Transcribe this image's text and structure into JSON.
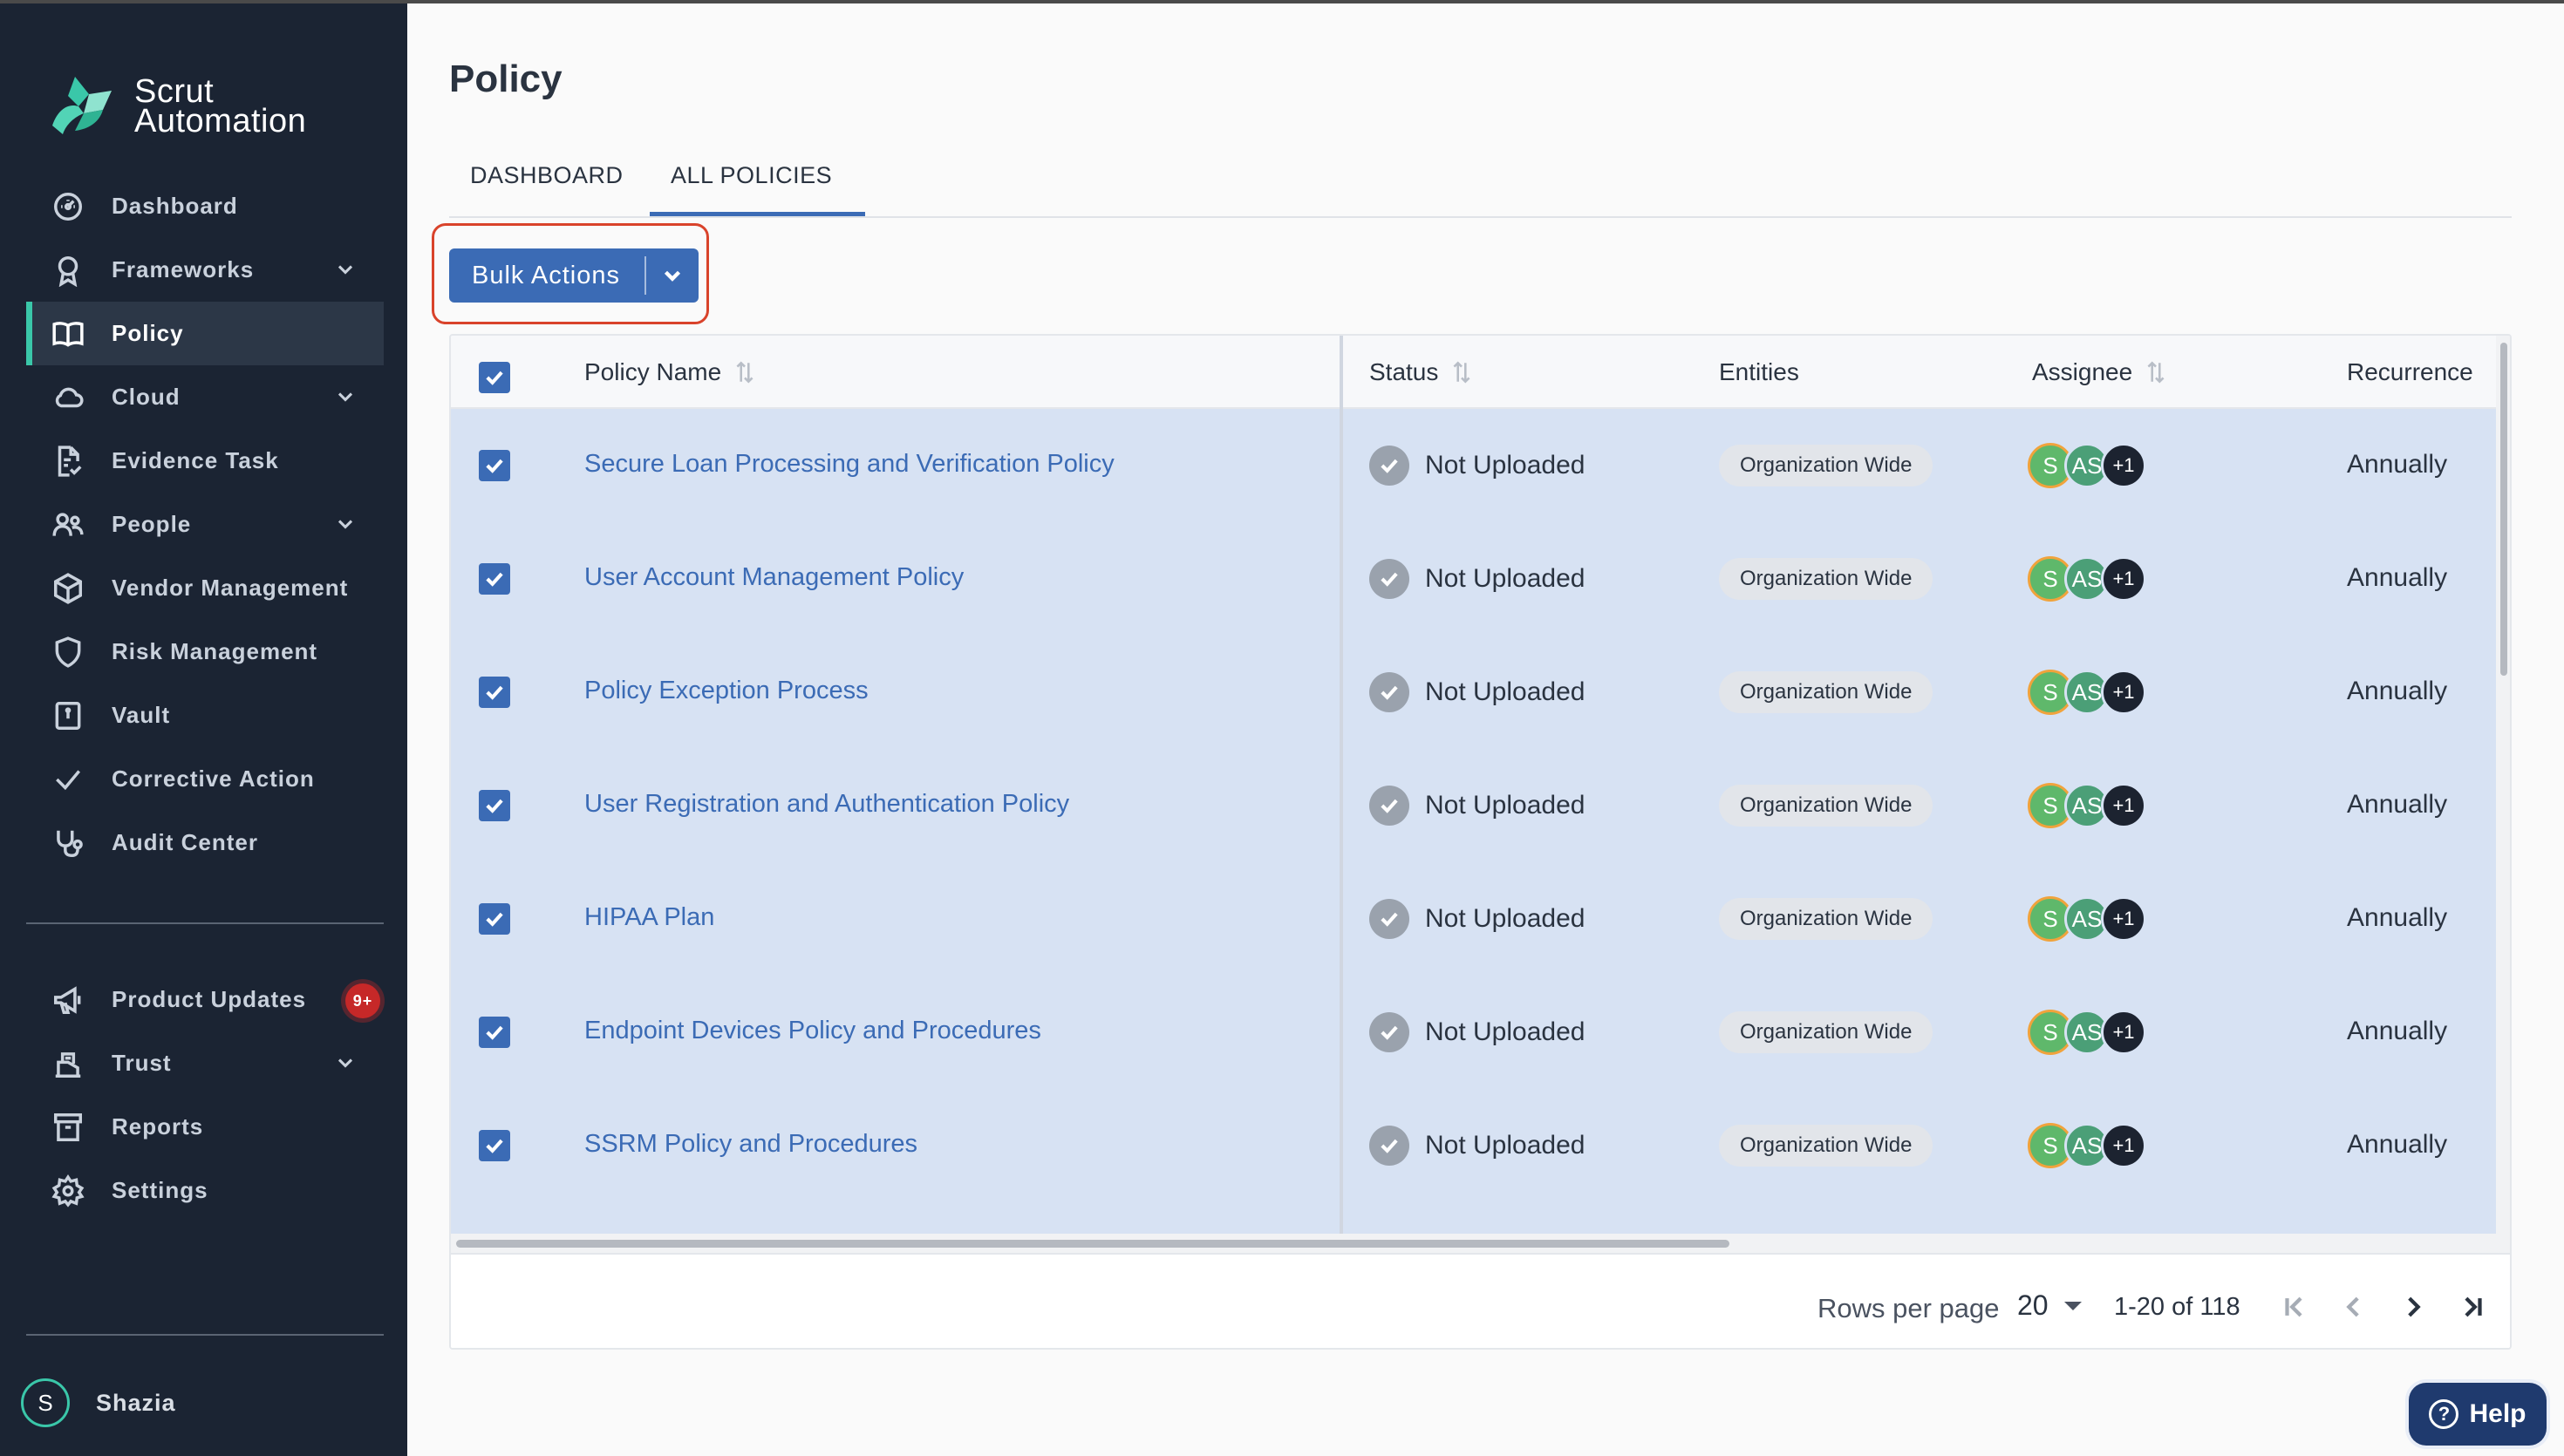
{
  "app": {
    "brand_line1": "Scrut",
    "brand_line2": "Automation"
  },
  "sidebar": {
    "items": [
      {
        "label": "Dashboard",
        "icon": "dashboard-gauge-icon",
        "expandable": false,
        "active": false
      },
      {
        "label": "Frameworks",
        "icon": "award-icon",
        "expandable": true,
        "active": false
      },
      {
        "label": "Policy",
        "icon": "book-icon",
        "expandable": false,
        "active": true
      },
      {
        "label": "Cloud",
        "icon": "cloud-icon",
        "expandable": true,
        "active": false
      },
      {
        "label": "Evidence Task",
        "icon": "file-check-icon",
        "expandable": false,
        "active": false
      },
      {
        "label": "People",
        "icon": "people-icon",
        "expandable": true,
        "active": false
      },
      {
        "label": "Vendor Management",
        "icon": "box-icon",
        "expandable": false,
        "active": false
      },
      {
        "label": "Risk Management",
        "icon": "shield-icon",
        "expandable": false,
        "active": false
      },
      {
        "label": "Vault",
        "icon": "vault-icon",
        "expandable": false,
        "active": false
      },
      {
        "label": "Corrective Action",
        "icon": "check-icon",
        "expandable": false,
        "active": false
      },
      {
        "label": "Audit Center",
        "icon": "stethoscope-icon",
        "expandable": false,
        "active": false
      }
    ],
    "secondary_items": [
      {
        "label": "Product Updates",
        "icon": "megaphone-icon",
        "expandable": false,
        "badge": "9+"
      },
      {
        "label": "Trust",
        "icon": "trust-icon",
        "expandable": true
      },
      {
        "label": "Reports",
        "icon": "archive-icon",
        "expandable": false
      },
      {
        "label": "Settings",
        "icon": "gear-icon",
        "expandable": false
      }
    ],
    "user": {
      "initial": "S",
      "name": "Shazia"
    }
  },
  "header": {
    "title": "Policy"
  },
  "tabs": [
    {
      "label": "DASHBOARD",
      "active": false
    },
    {
      "label": "ALL POLICIES",
      "active": true
    }
  ],
  "bulk_actions": {
    "label": "Bulk Actions"
  },
  "table": {
    "columns": [
      "Policy Name",
      "Status",
      "Entities",
      "Assignee",
      "Recurrence"
    ],
    "rows": [
      {
        "name": "Secure Loan Processing and Verification Policy",
        "status": "Not Uploaded",
        "entity": "Organization Wide",
        "assignees": [
          "S",
          "AS",
          "+1"
        ],
        "recurrence": "Annually"
      },
      {
        "name": "User Account Management Policy",
        "status": "Not Uploaded",
        "entity": "Organization Wide",
        "assignees": [
          "S",
          "AS",
          "+1"
        ],
        "recurrence": "Annually"
      },
      {
        "name": "Policy Exception Process",
        "status": "Not Uploaded",
        "entity": "Organization Wide",
        "assignees": [
          "S",
          "AS",
          "+1"
        ],
        "recurrence": "Annually"
      },
      {
        "name": "User Registration and Authentication Policy",
        "status": "Not Uploaded",
        "entity": "Organization Wide",
        "assignees": [
          "S",
          "AS",
          "+1"
        ],
        "recurrence": "Annually"
      },
      {
        "name": "HIPAA Plan",
        "status": "Not Uploaded",
        "entity": "Organization Wide",
        "assignees": [
          "S",
          "AS",
          "+1"
        ],
        "recurrence": "Annually"
      },
      {
        "name": "Endpoint Devices Policy and Procedures",
        "status": "Not Uploaded",
        "entity": "Organization Wide",
        "assignees": [
          "S",
          "AS",
          "+1"
        ],
        "recurrence": "Annually"
      },
      {
        "name": "SSRM Policy and Procedures",
        "status": "Not Uploaded",
        "entity": "Organization Wide",
        "assignees": [
          "S",
          "AS",
          "+1"
        ],
        "recurrence": "Annually"
      }
    ]
  },
  "pagination": {
    "rows_per_page_label": "Rows per page",
    "rows_per_page": "20",
    "range": "1-20 of 118"
  },
  "help": {
    "label": "Help"
  },
  "colors": {
    "accent": "#3b6bb5",
    "sidebar_bg": "#1b2433",
    "active_marker": "#3ac7a9",
    "highlight_outline": "#d9432b"
  }
}
